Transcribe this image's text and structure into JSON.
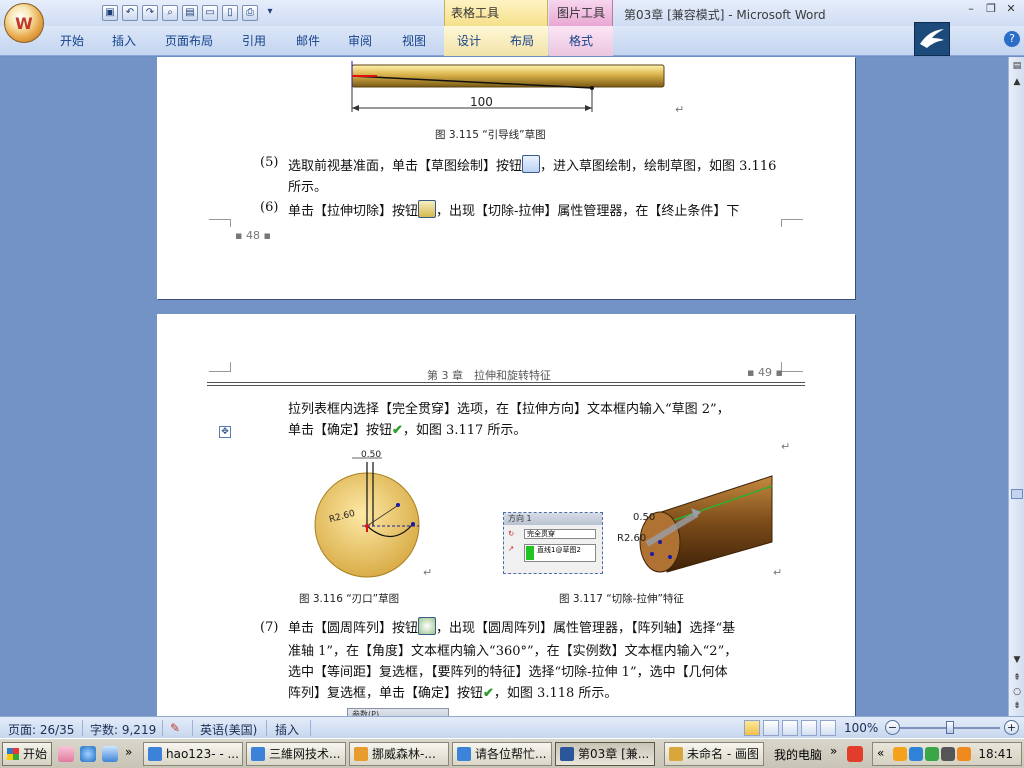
{
  "window": {
    "title": "第03章 [兼容模式] - Microsoft Word",
    "office_button_glyph": "W",
    "context_tab_groups": [
      "表格工具",
      "图片工具"
    ],
    "controls": [
      "–",
      "❐",
      "✕"
    ]
  },
  "quick_access": [
    "save",
    "undo",
    "redo",
    "print-preview",
    "new",
    "open",
    "blank",
    "print",
    "customize"
  ],
  "ribbon": {
    "tabs": [
      "开始",
      "插入",
      "页面布局",
      "引用",
      "邮件",
      "审阅",
      "视图",
      "设计",
      "布局",
      "格式"
    ],
    "help_label": "?"
  },
  "page1": {
    "dimension_label": "100",
    "figure_caption": "图 3.115 “引导线”草图",
    "step5_num": "(5)",
    "step5_line1": "选取前视基准面，单击【草图绘制】按钮",
    "step5_line1b": "，进入草图绘制，绘制草图，如图 3.116",
    "step5_line2": "所示。",
    "step6_num": "(6)",
    "step6_line1": "单击【拉伸切除】按钮",
    "step6_line1b": "，出现【切除-拉伸】属性管理器，在【终止条件】下",
    "page_number": "▪ 48 ▪"
  },
  "page2": {
    "header_chapter": "第 3 章　拉伸和旋转特征",
    "page_number": "▪ 49 ▪",
    "para_line1": "拉列表框内选择【完全贯穿】选项，在【拉伸方向】文本框内输入“草图 2”，",
    "para_line2a": "单击【确定】按钮",
    "para_line2b": "，如图 3.117 所示。",
    "sketch_dim_top": "0.50",
    "sketch_dim_radius": "R2.60",
    "fig116_caption": "图 3.116 “刃口”草图",
    "fig117_caption": "图 3.117 “切除-拉伸”特征",
    "model_dim_top": "0.50",
    "model_dim_radius": "R2.60",
    "prop_panel": {
      "header": "方向 1",
      "select_value": "完全贯穿",
      "list_value": "直线1@草图2"
    },
    "step7_num": "(7)",
    "step7_line1a": "单击【圆周阵列】按钮",
    "step7_line1b": "，出现【圆周阵列】属性管理器，【阵列轴】选择“基",
    "step7_line2": "准轴 1”，在【角度】文本框内输入“360°”，在【实例数】文本框内输入“2”，",
    "step7_line3": "选中【等间距】复选框，【要阵列的特征】选择“切除-拉伸 1”，选中【几何体",
    "step7_line4a": "阵列】复选框，单击【确定】按钮",
    "step7_line4b": "，如图 3.118 所示。",
    "next_panel_header": "参数(P)"
  },
  "statusbar": {
    "page": "页面: 26/35",
    "words": "字数: 9,219",
    "language": "英语(美国)",
    "mode": "插入",
    "zoom": "100%",
    "zoom_level": 1.0
  },
  "taskbar": {
    "start": "开始",
    "expand": "»",
    "items": [
      {
        "label": "hao123- - ...",
        "color": "#3b82d8"
      },
      {
        "label": "三維网技术...",
        "color": "#3b82d8"
      },
      {
        "label": "挪威森林-...",
        "color": "#e89b2e"
      },
      {
        "label": "请各位帮忙...",
        "color": "#3b82d8"
      },
      {
        "label": "第03章 [兼...",
        "color": "#2b579a"
      },
      {
        "label": "未命名 - 画图",
        "color": "#d8a63b"
      }
    ],
    "desktop_label": "我的电脑",
    "tray_expand": "«",
    "clock": "18:41"
  }
}
